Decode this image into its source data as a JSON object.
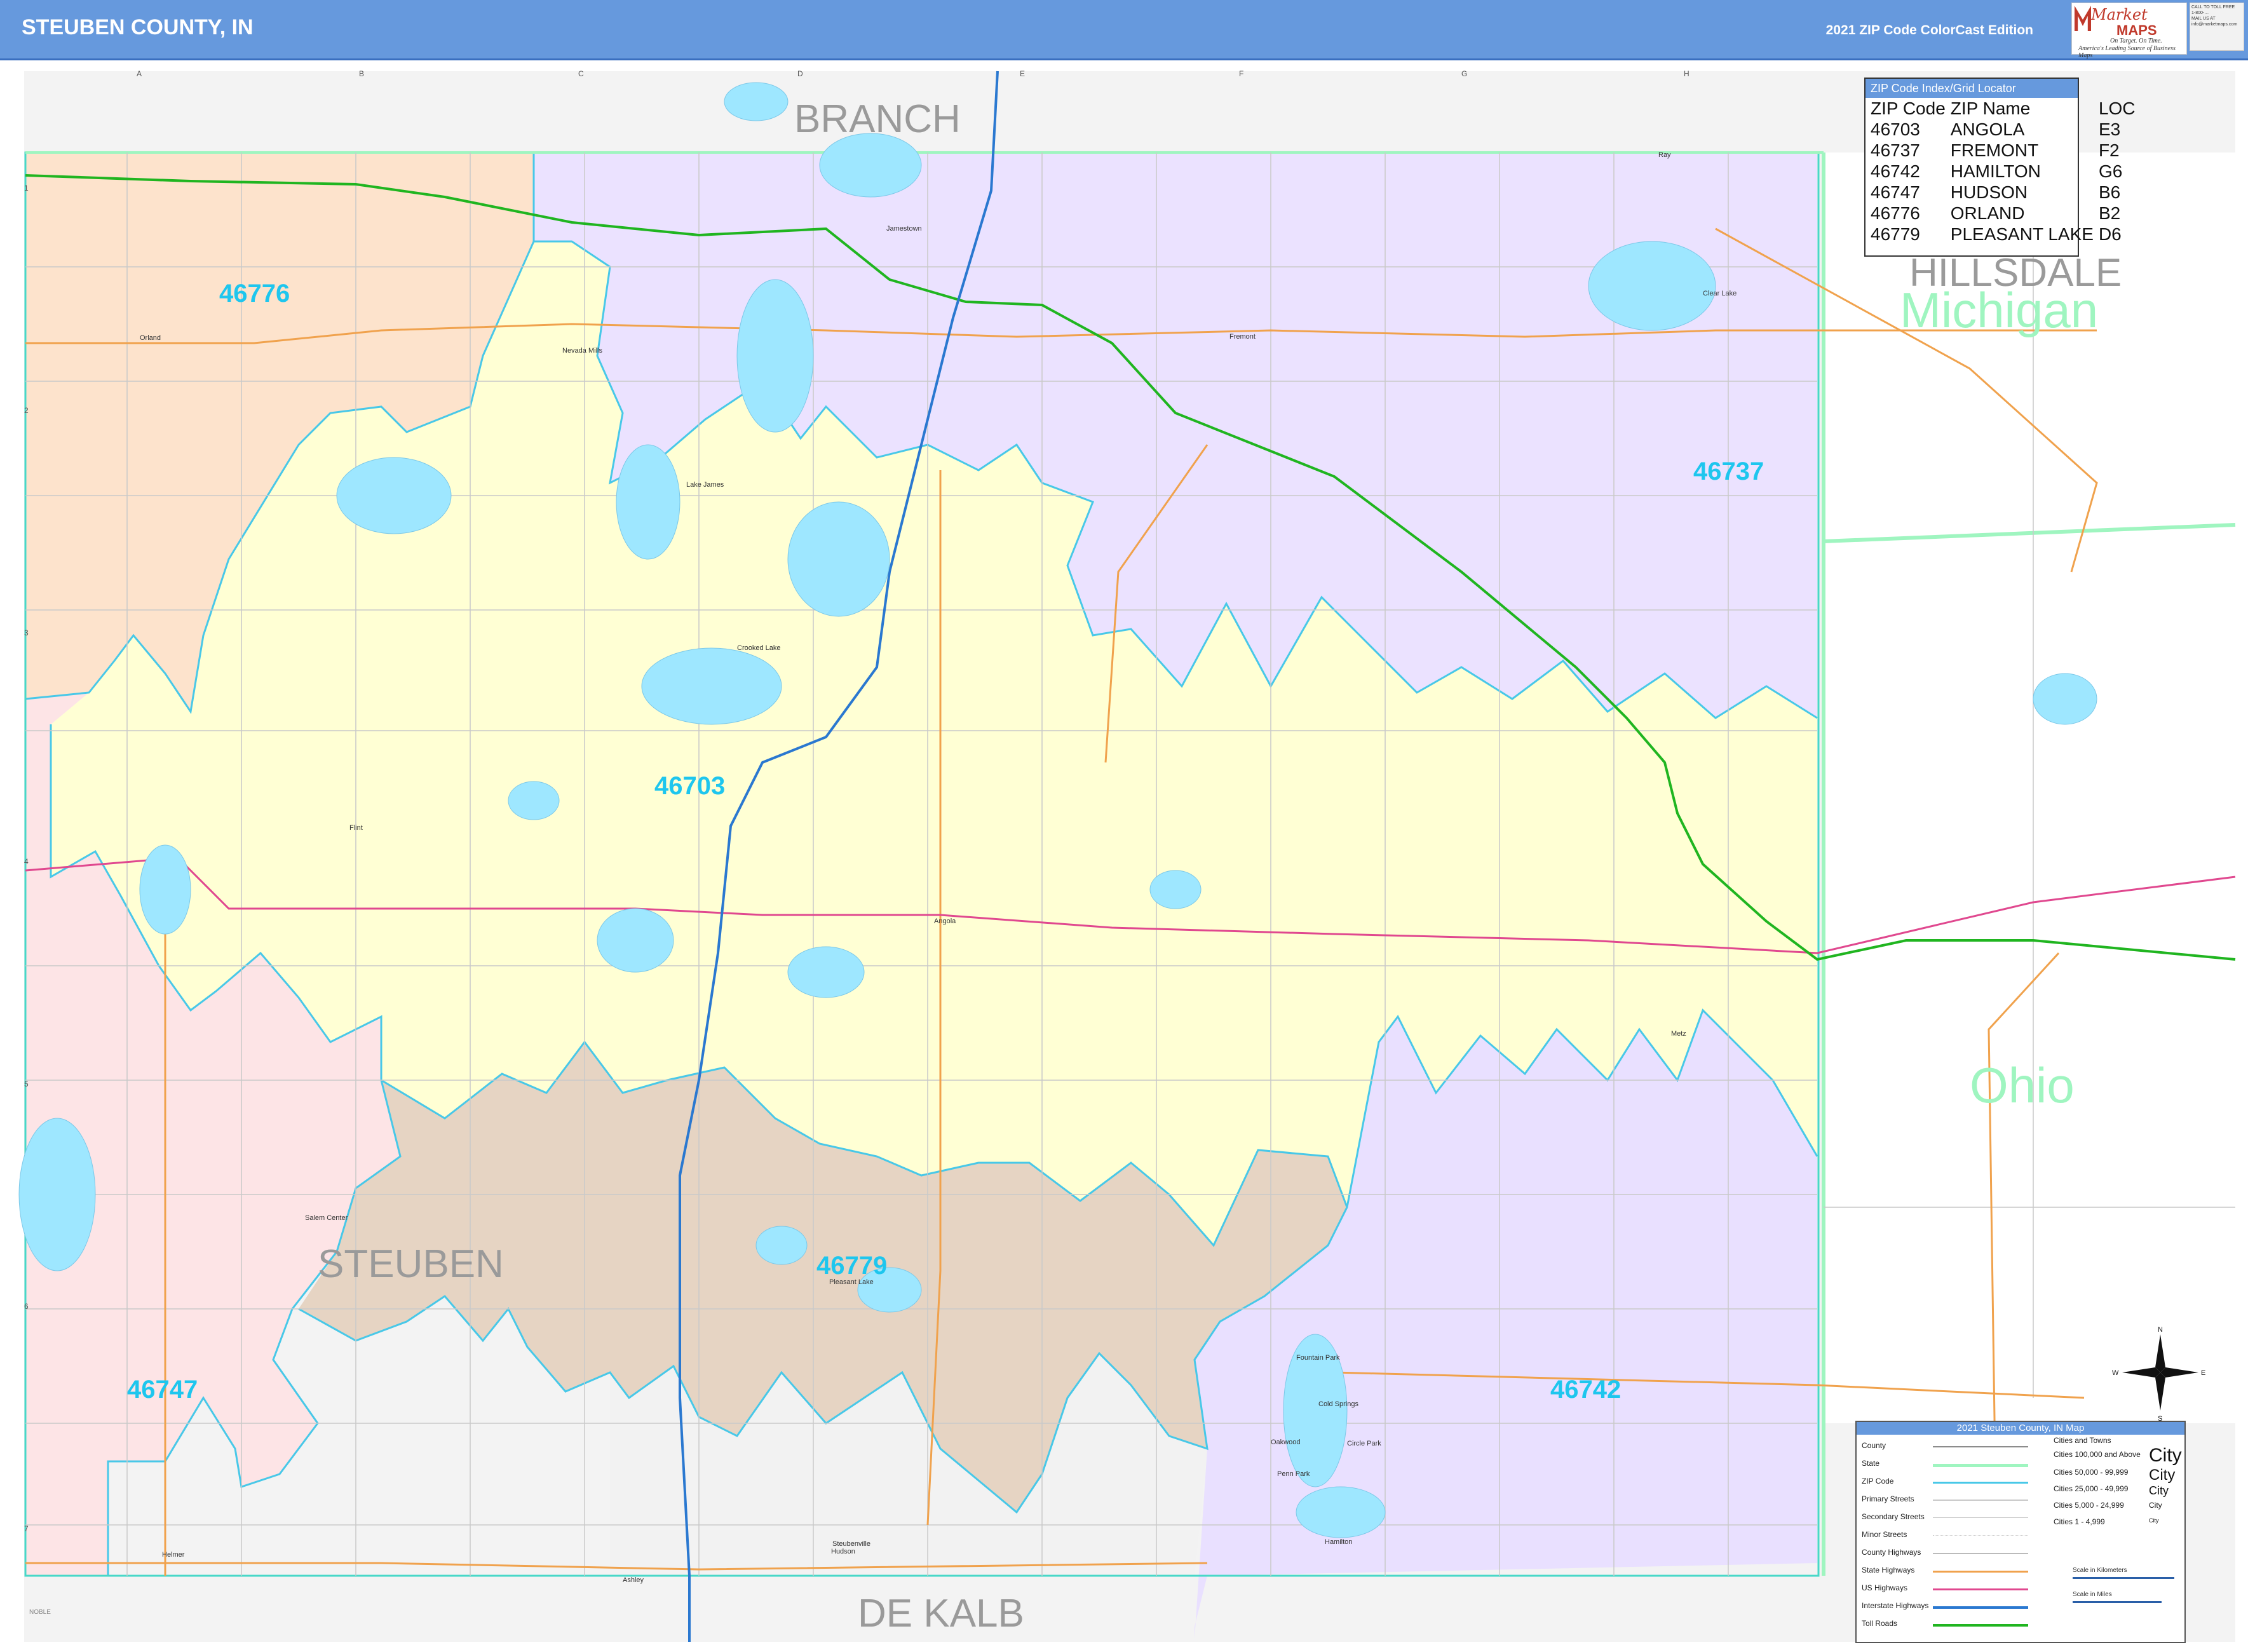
{
  "header": {
    "title": "STEUBEN COUNTY, IN",
    "edition": "2021 ZIP Code ColorCast Edition",
    "logo_top": "Market",
    "logo_bottom": "MAPS",
    "logo_tag1": "On Target. On Time.",
    "logo_tag2": "America's Leading Source of Business Maps",
    "contact_lines": [
      "CALL TO TOLL FREE",
      "1-800-…",
      "MAIL US AT",
      "info@marketmaps.com"
    ]
  },
  "colors": {
    "header_bg": "#6699dd",
    "zip_46703": "#ffffd4",
    "zip_46737": "#ebe2ff",
    "zip_46742": "#e9e0ff",
    "zip_46747": "#fde4e6",
    "zip_46776": "#fde3cc",
    "zip_46779": "#e6d4c3",
    "outside_gray": "#f2f2f2",
    "water": "#9ee7ff",
    "toll_road": "#20b520",
    "interstate": "#2a78d0",
    "us_highway": "#e0488f",
    "zip_boundary": "#48c8e8",
    "zip_label": "#1ec6ee",
    "state_line": "#9ff5c0",
    "county_line": "#8c8c8c"
  },
  "neighbors": {
    "north": "BRANCH",
    "north_east": "HILLSDALE",
    "state_east": "Michigan",
    "ohio": "Ohio",
    "south": "DE KALB",
    "county": "STEUBEN",
    "south_west_small": "NOBLE"
  },
  "zip_labels": [
    "46776",
    "46737",
    "46703",
    "46779",
    "46747",
    "46742"
  ],
  "places": [
    "Orland",
    "Nevada Mills",
    "Jamestown",
    "Fremont",
    "Clear Lake",
    "Ray",
    "Lake James",
    "Crooked Lake",
    "Flint",
    "Angola",
    "Metz",
    "Salem Center",
    "Pleasant Lake",
    "Fountain Park",
    "Cold Springs",
    "Oakwood",
    "Circle Park",
    "Penn Park",
    "Hamilton",
    "Steubenville",
    "Hudson",
    "Helmer",
    "Ashley"
  ],
  "grid": {
    "columns": [
      "A",
      "B",
      "C",
      "D",
      "E",
      "F",
      "G",
      "H"
    ],
    "rows": [
      "1",
      "2",
      "3",
      "4",
      "5",
      "6",
      "7"
    ]
  },
  "zip_index": {
    "title": "ZIP Code Index/Grid Locator",
    "columns": [
      "ZIP Code",
      "ZIP Name",
      "LOC"
    ],
    "rows": [
      [
        "46703",
        "ANGOLA",
        "E3"
      ],
      [
        "46737",
        "FREMONT",
        "F2"
      ],
      [
        "46742",
        "HAMILTON",
        "G6"
      ],
      [
        "46747",
        "HUDSON",
        "B6"
      ],
      [
        "46776",
        "ORLAND",
        "B2"
      ],
      [
        "46779",
        "PLEASANT LAKE",
        "D6"
      ]
    ]
  },
  "legend": {
    "title": "2021 Steuben County, IN Map",
    "items": [
      "County",
      "State",
      "ZIP Code",
      "Primary Streets",
      "Secondary Streets",
      "Minor Streets",
      "County Highways",
      "State Highways",
      "US Highways",
      "Interstate Highways",
      "Toll Roads"
    ],
    "cities": [
      "Cities and Towns",
      "Cities 100,000 and Above",
      "Cities 50,000 - 99,999",
      "Cities 25,000 - 49,999",
      "Cities 5,000 - 24,999",
      "Cities 1 - 4,999"
    ],
    "city_samples": [
      "City",
      "City",
      "City",
      "City",
      "City"
    ],
    "scale_km": "Scale in Kilometers",
    "scale_mi": "Scale in Miles"
  },
  "compass": {
    "n": "N",
    "s": "S",
    "e": "E",
    "w": "W"
  }
}
